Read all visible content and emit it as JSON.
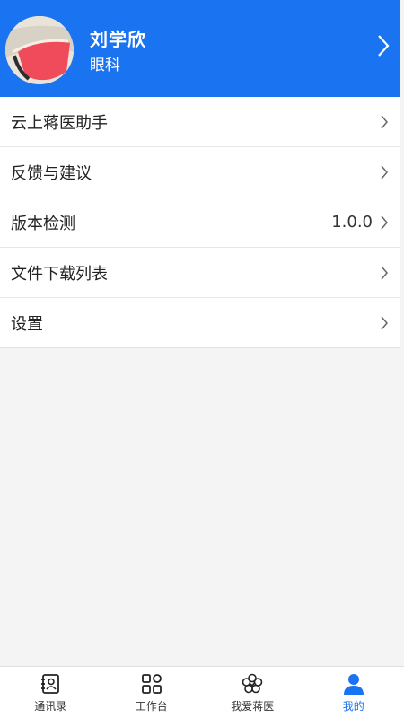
{
  "profile": {
    "name": "刘学欣",
    "department": "眼科"
  },
  "menu": {
    "items": [
      {
        "label": "云上蒋医助手",
        "value": ""
      },
      {
        "label": "反馈与建议",
        "value": ""
      },
      {
        "label": "版本检测",
        "value": "1.0.0"
      },
      {
        "label": "文件下载列表",
        "value": ""
      },
      {
        "label": "设置",
        "value": ""
      }
    ]
  },
  "tabbar": {
    "items": [
      {
        "label": "通讯录",
        "icon": "contacts-icon",
        "active": false
      },
      {
        "label": "工作台",
        "icon": "grid-icon",
        "active": false
      },
      {
        "label": "我爱蒋医",
        "icon": "flower-logo-icon",
        "active": false
      },
      {
        "label": "我的",
        "icon": "person-icon",
        "active": true
      }
    ]
  },
  "colors": {
    "primary": "#1a73f0",
    "background": "#f4f4f4",
    "text": "#222222"
  }
}
